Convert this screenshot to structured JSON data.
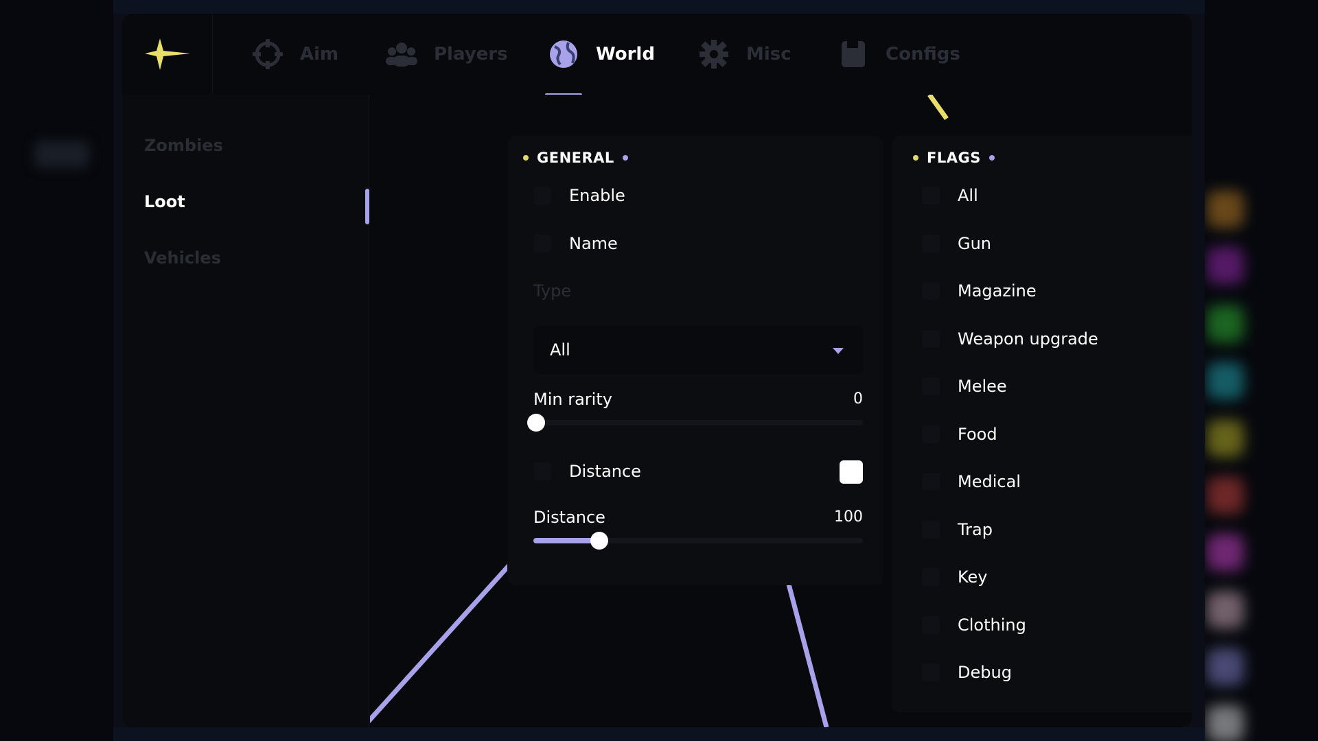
{
  "nav": {
    "logo_icon": "sparkle-star-icon",
    "tabs": [
      {
        "label": "Aim",
        "icon": "crosshair-icon",
        "active": false
      },
      {
        "label": "Players",
        "icon": "users-icon",
        "active": false
      },
      {
        "label": "World",
        "icon": "globe-icon",
        "active": true
      },
      {
        "label": "Misc",
        "icon": "gear-icon",
        "active": false
      },
      {
        "label": "Configs",
        "icon": "save-icon",
        "active": false
      }
    ]
  },
  "sidebar": {
    "items": [
      {
        "label": "Zombies",
        "active": false
      },
      {
        "label": "Loot",
        "active": true
      },
      {
        "label": "Vehicles",
        "active": false
      }
    ]
  },
  "general": {
    "title": "GENERAL",
    "enable_label": "Enable",
    "name_label": "Name",
    "type_label": "Type",
    "type_value": "All",
    "min_rarity_label": "Min rarity",
    "min_rarity_value": "0",
    "min_rarity_fraction": 0.0,
    "distance_toggle_label": "Distance",
    "distance_color": "#ffffff",
    "distance_slider_label": "Distance",
    "distance_slider_value": "100",
    "distance_slider_fraction": 0.2
  },
  "flags": {
    "title": "FLAGS",
    "items": [
      {
        "label": "All",
        "color": ""
      },
      {
        "label": "Gun",
        "color": "#e0962a"
      },
      {
        "label": "Magazine",
        "color": "#b52fd2"
      },
      {
        "label": "Weapon upgrade",
        "color": "#35d43a"
      },
      {
        "label": "Melee",
        "color": "#27c3d1"
      },
      {
        "label": "Food",
        "color": "#d9d02b"
      },
      {
        "label": "Medical",
        "color": "#eb4c48"
      },
      {
        "label": "Trap",
        "color": "#ef4cec"
      },
      {
        "label": "Key",
        "color": "#f5cadb"
      },
      {
        "label": "Clothing",
        "color": "#9a98f0"
      },
      {
        "label": "Debug",
        "color": "#ffffff"
      }
    ]
  },
  "colors": {
    "accent": "#a7a2ea",
    "dot_yellow": "#e2d96b"
  }
}
